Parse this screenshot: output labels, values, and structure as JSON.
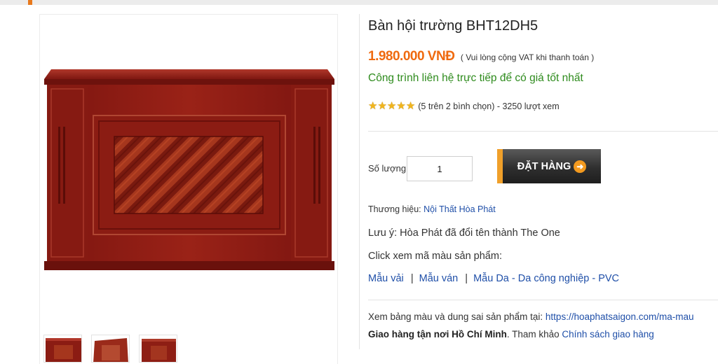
{
  "product": {
    "title": "Bàn hội trường BHT12DH5",
    "price": "1.980.000 VNĐ",
    "vat_note": "( Vui lòng cộng VAT khi thanh toán )",
    "contact_note": "Công trình liên hệ trực tiếp để có giá tốt nhất",
    "rating": {
      "stars": 5,
      "text": "(5 trên 2 bình chọn) - 3250 lượt xem"
    }
  },
  "order": {
    "quantity_label": "Số lượng",
    "quantity_value": "1",
    "button_label": "ĐẶT HÀNG",
    "button_arrow_icon": "arrow-right-circle-icon"
  },
  "details": {
    "brand_label": "Thương hiệu:",
    "brand_link": "Nội Thất Hòa Phát",
    "note": "Lưu ý: Hòa Phát đã đổi tên thành The One",
    "swatch_title": "Click xem mã màu sản phẩm:",
    "swatch_links": [
      "Mẫu vải",
      "Mẫu ván",
      "Mẫu Da - Da công nghiệp - PVC"
    ],
    "swatch_sep": "|",
    "tolerance_text": "Xem bảng màu và dung sai sản phẩm tại:",
    "tolerance_link": "https://hoaphatsaigon.com/ma-mau",
    "delivery_bold": "Giao hàng tận nơi Hồ Chí Minh",
    "delivery_text": ". Tham khảo",
    "delivery_link": "Chính sách giao hàng"
  },
  "gallery": {
    "thumbnail_count": 3
  },
  "colors": {
    "accent": "#e8791c",
    "price": "#ef6a0f",
    "contact": "#2e8b1d",
    "link": "#1f4fa8",
    "star": "#f1b51c",
    "wood": "#8e1a12"
  }
}
